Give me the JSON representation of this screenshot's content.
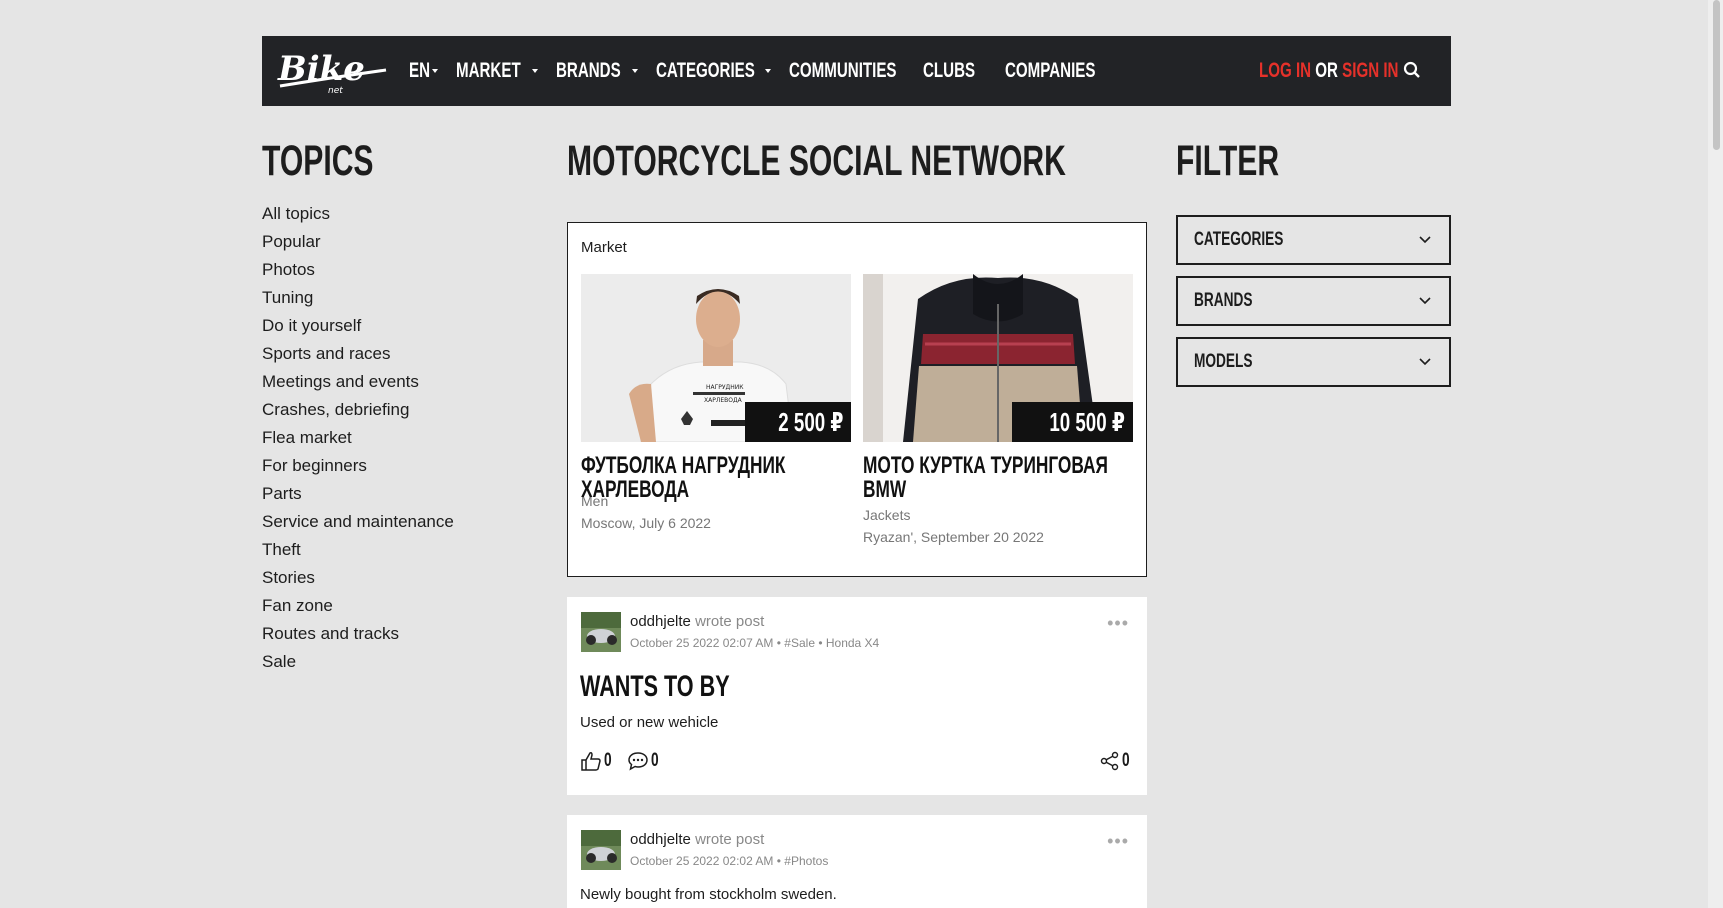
{
  "header": {
    "nav": [
      {
        "label": "EN",
        "dropdown": true
      },
      {
        "label": "MARKET",
        "dropdown": true
      },
      {
        "label": "BRANDS",
        "dropdown": true
      },
      {
        "label": "CATEGORIES",
        "dropdown": true
      },
      {
        "label": "COMMUNITIES",
        "dropdown": false
      },
      {
        "label": "CLUBS",
        "dropdown": false
      },
      {
        "label": "COMPANIES",
        "dropdown": false
      }
    ],
    "login": "LOG IN",
    "or": "OR",
    "signin": "SIGN IN"
  },
  "topics": {
    "title": "TOPICS",
    "items": [
      "All topics",
      "Popular",
      "Photos",
      "Tuning",
      "Do it yourself",
      "Sports and races",
      "Meetings and events",
      "Crashes, debriefing",
      "Flea market",
      "For beginners",
      "Parts",
      "Service and maintenance",
      "Theft",
      "Stories",
      "Fan zone",
      "Routes and tracks",
      "Sale"
    ]
  },
  "main": {
    "title": "MOTORCYCLE SOCIAL NETWORK",
    "market": {
      "label": "Market",
      "products": [
        {
          "title": "ФУТБОЛКА НАГРУДНИК ХАРЛЕВОДА",
          "price": "2 500 ₽",
          "category": "Men",
          "location": "Moscow, July 6 2022"
        },
        {
          "title": "МОТО КУРТКА ТУРИНГОВАЯ BMW",
          "price": "10 500 ₽",
          "category": "Jackets",
          "location": "Ryazan', September 20 2022"
        }
      ]
    },
    "posts": [
      {
        "author": "oddhjelte",
        "action": "wrote post",
        "meta": "October 25 2022 02:07 AM • #Sale • Honda X4",
        "title": "WANTS TO BY",
        "body": "Used or new wehicle",
        "likes": "0",
        "comments": "0",
        "shares": "0"
      },
      {
        "author": "oddhjelte",
        "action": "wrote post",
        "meta": "October 25 2022 02:02 AM • #Photos",
        "body": "Newly bought from stockholm sweden."
      }
    ]
  },
  "filter": {
    "title": "FILTER",
    "items": [
      "CATEGORIES",
      "BRANDS",
      "MODELS"
    ]
  },
  "colors": {
    "header_bg": "#222326",
    "accent": "#e5312a",
    "page_bg": "#e5e5e5"
  }
}
